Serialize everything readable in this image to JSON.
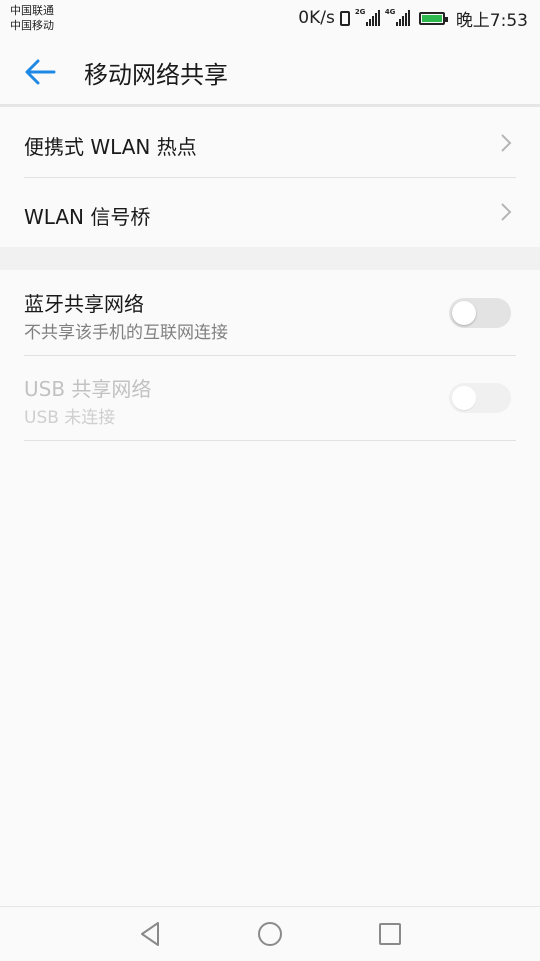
{
  "status_bar": {
    "carrier_1": "中国联通",
    "carrier_2": "中国移动",
    "net_speed": "0K/s",
    "sim1_tag": "2G",
    "sim2_tag": "4G",
    "time": "晚上7:53",
    "battery_color": "#2db84d"
  },
  "app_bar": {
    "back_icon": "arrow-left-icon",
    "title": "移动网络共享",
    "accent_color": "#1e88e5"
  },
  "section_1": [
    {
      "label": "便携式 WLAN 热点",
      "icon": "chevron-right-icon"
    },
    {
      "label": "WLAN 信号桥",
      "icon": "chevron-right-icon"
    }
  ],
  "section_2": [
    {
      "label": "蓝牙共享网络",
      "subtitle": "不共享该手机的互联网连接",
      "toggle": false,
      "enabled": true
    },
    {
      "label": "USB 共享网络",
      "subtitle": "USB 未连接",
      "toggle": false,
      "enabled": false
    }
  ],
  "nav_bar": {
    "back": "triangle-back-icon",
    "home": "circle-home-icon",
    "recents": "square-recents-icon"
  }
}
